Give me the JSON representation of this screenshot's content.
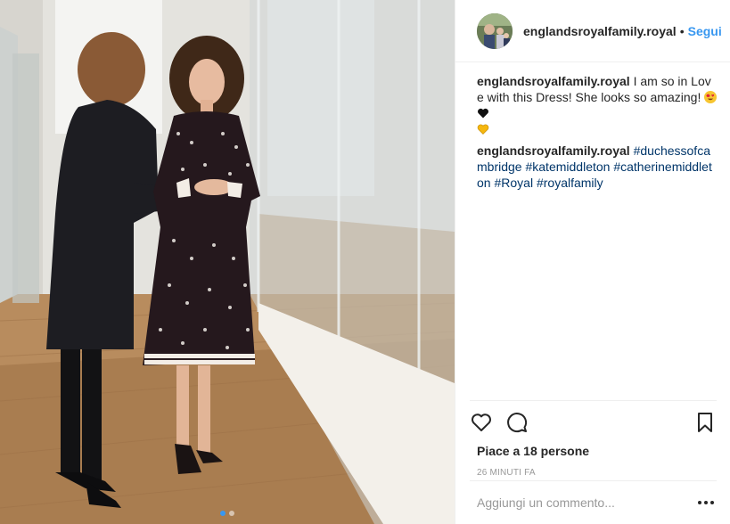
{
  "post": {
    "image_alt": "Photo",
    "carousel": {
      "count": 2,
      "active": 0
    }
  },
  "header": {
    "username": "englandsroyalfamily.royal",
    "separator": "•",
    "follow_label": "Segui"
  },
  "caption": {
    "username": "englandsroyalfamily.royal",
    "text": " I am so in Love with this Dress! She looks so amazing! ",
    "emojis": [
      "heart-eyes-emoji",
      "black-heart-emoji",
      "yellow-heart-emoji"
    ]
  },
  "comment": {
    "username": "englandsroyalfamily.royal",
    "hashtags": [
      "#duchessofcambridge",
      "#katemiddleton",
      "#catherinemiddleton",
      "#Royal",
      "#royalfamily"
    ]
  },
  "actions": {
    "icons": [
      "heart-icon",
      "comment-icon",
      "bookmark-icon"
    ]
  },
  "likes": "Piace a 18 persone",
  "timestamp": "26 MINUTI FA",
  "add_comment": {
    "placeholder": "Aggiungi un commento...",
    "more_icon": "more-options-icon"
  },
  "colors": {
    "link_blue": "#3897f0",
    "hashtag_blue": "#003569",
    "muted": "#999999",
    "text": "#262626"
  }
}
